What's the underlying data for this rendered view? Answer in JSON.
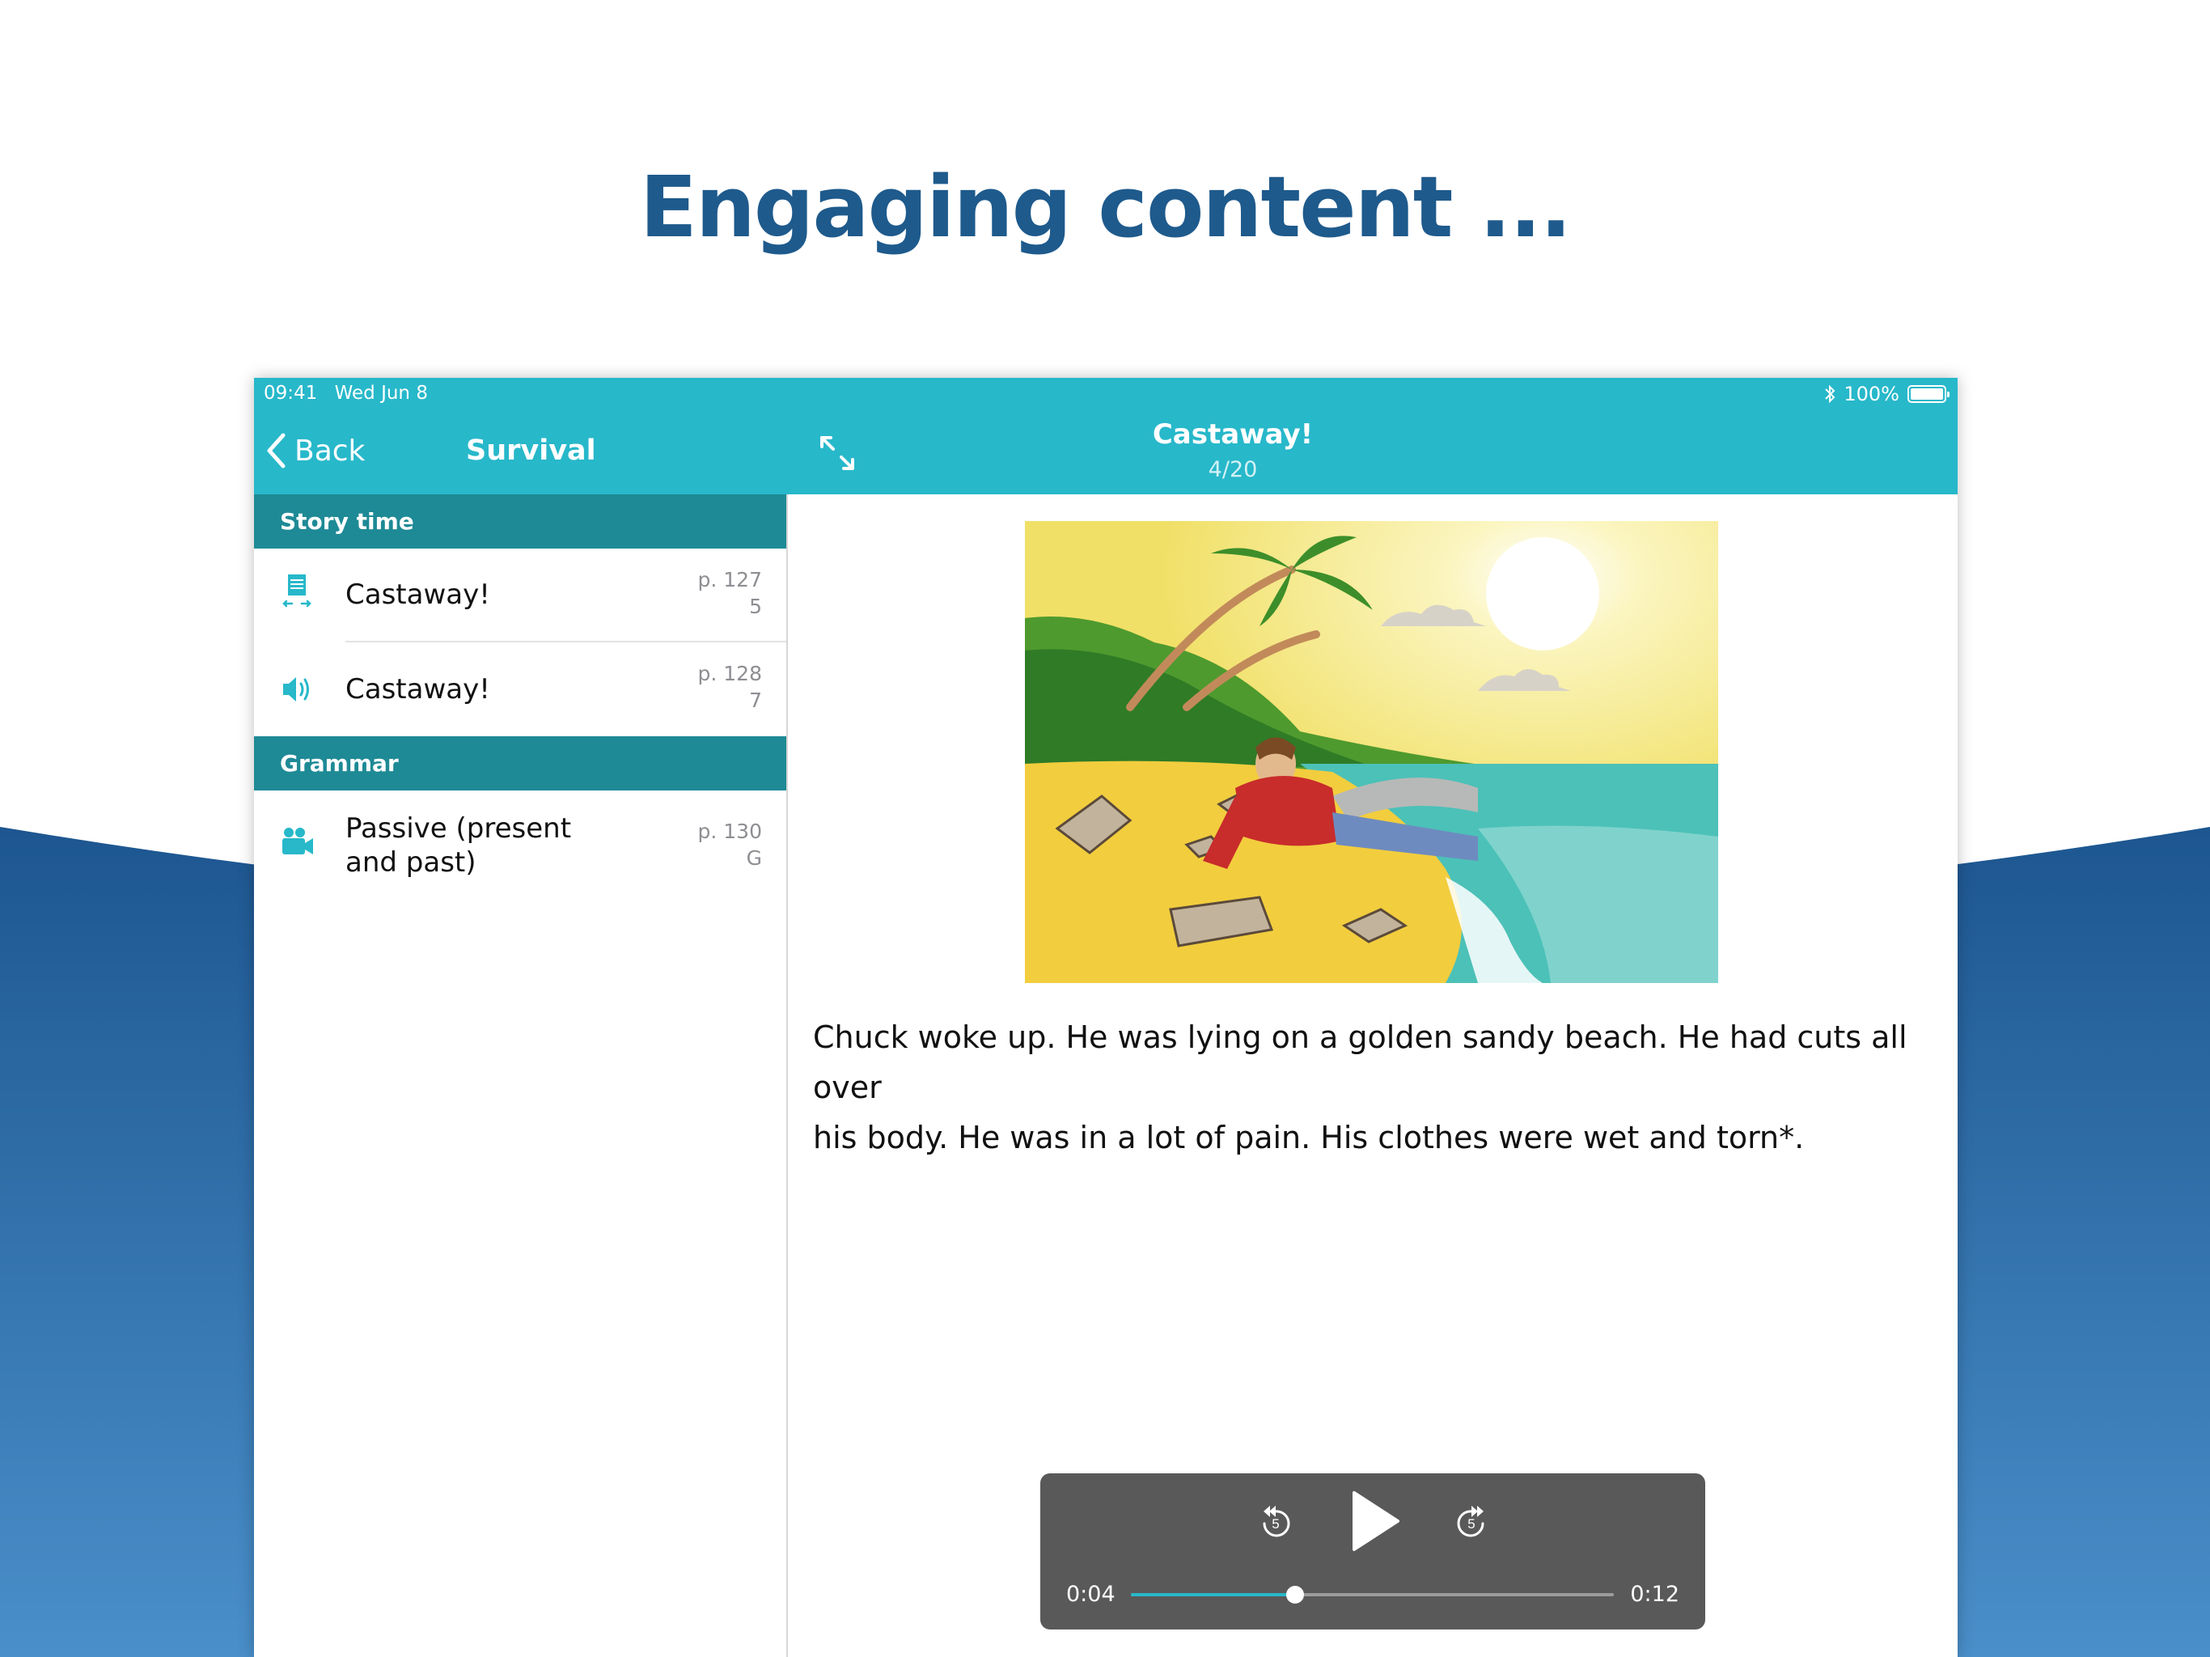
{
  "headline": "Engaging content ...",
  "status_bar": {
    "time": "09:41",
    "date": "Wed Jun 8",
    "battery": "100%"
  },
  "nav": {
    "back_label": "Back",
    "title": "Survival"
  },
  "sidebar": {
    "sections": [
      {
        "header": "Story time",
        "items": [
          {
            "icon": "document-icon",
            "title": "Castaway!",
            "page": "p. 127",
            "code": "5"
          },
          {
            "icon": "speaker-icon",
            "title": "Castaway!",
            "page": "p. 128",
            "code": "7"
          }
        ]
      },
      {
        "header": "Grammar",
        "items": [
          {
            "icon": "video-camera-icon",
            "title_line1": "Passive (present",
            "title_line2": "and past)",
            "page": "p. 130",
            "code": "G"
          }
        ]
      }
    ]
  },
  "detail": {
    "title": "Castaway!",
    "subtitle": "4/20",
    "text_line1": "Chuck woke up. He was lying on a golden sandy beach. He had cuts all over",
    "text_line2": "his body. He was in a lot of pain. His clothes were wet and torn*."
  },
  "player": {
    "rewind_label": "5",
    "forward_label": "5",
    "elapsed": "0:04",
    "duration": "0:12",
    "progress_fraction": 0.34
  },
  "colors": {
    "accent": "#27b8ca",
    "section_header": "#1e8a96",
    "headline": "#1e5a8c",
    "player_bg": "#595959"
  }
}
